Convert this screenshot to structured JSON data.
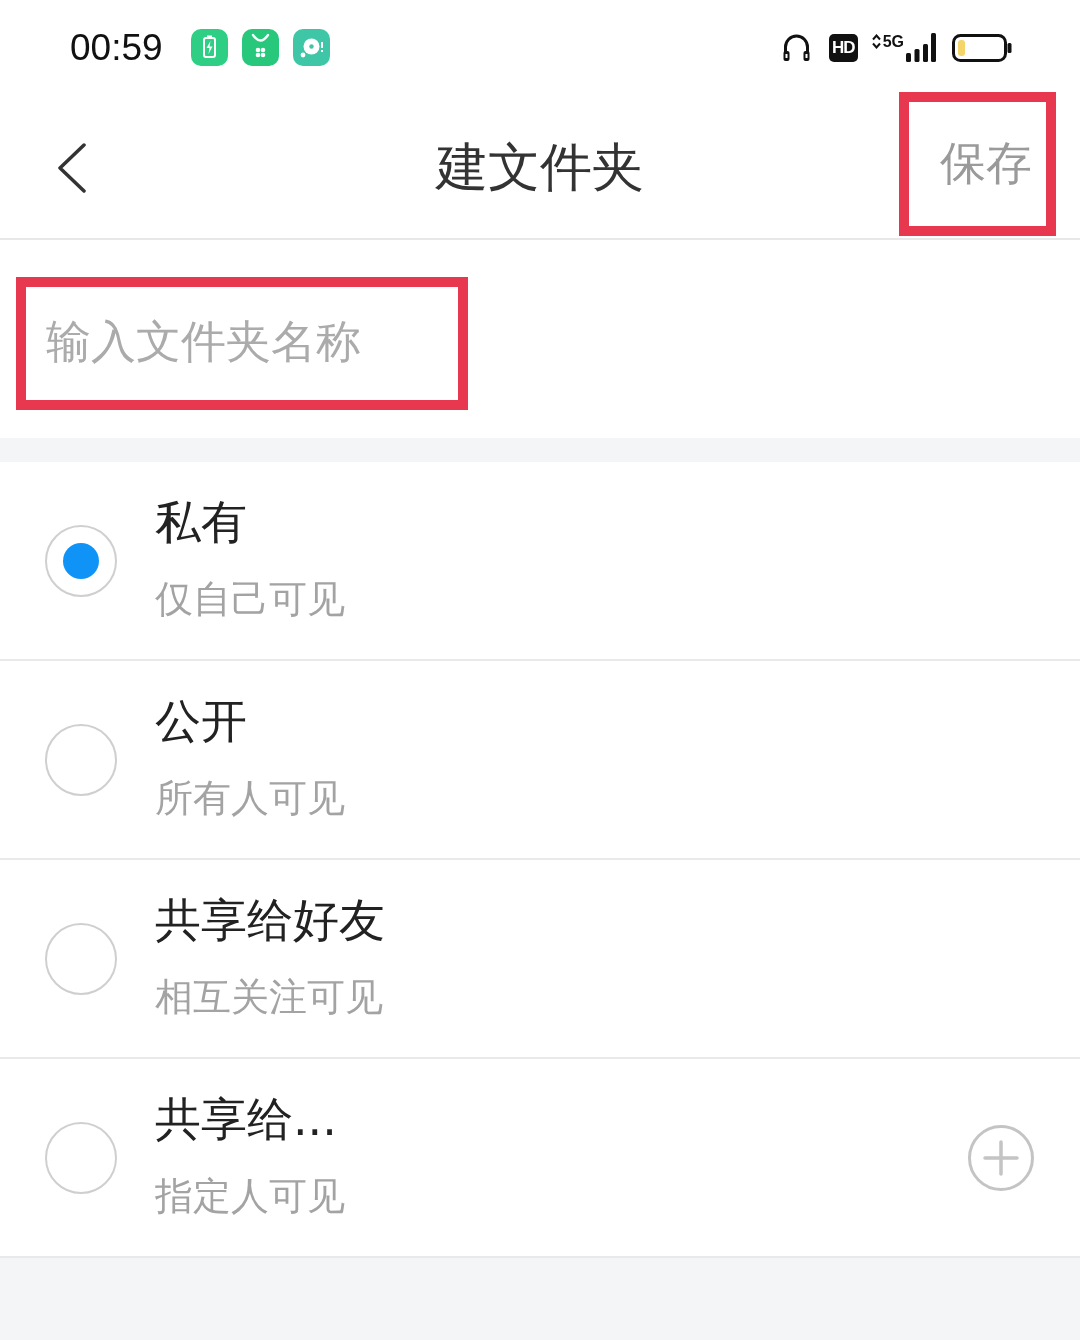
{
  "status_bar": {
    "time": "00:59",
    "hd_badge": "HD",
    "network": "5G"
  },
  "nav": {
    "title": "建文件夹",
    "save": {
      "label": "保存",
      "highlighted": true
    }
  },
  "name_field": {
    "placeholder": "输入文件夹名称",
    "highlighted": true
  },
  "visibility_options": [
    {
      "title": "私有",
      "subtitle": "仅自己可见",
      "selected": true,
      "add_button": false
    },
    {
      "title": "公开",
      "subtitle": "所有人可见",
      "selected": false,
      "add_button": false
    },
    {
      "title": "共享给好友",
      "subtitle": "相互关注可见",
      "selected": false,
      "add_button": false
    },
    {
      "title": "共享给...",
      "subtitle": "指定人可见",
      "selected": false,
      "add_button": true
    }
  ]
}
